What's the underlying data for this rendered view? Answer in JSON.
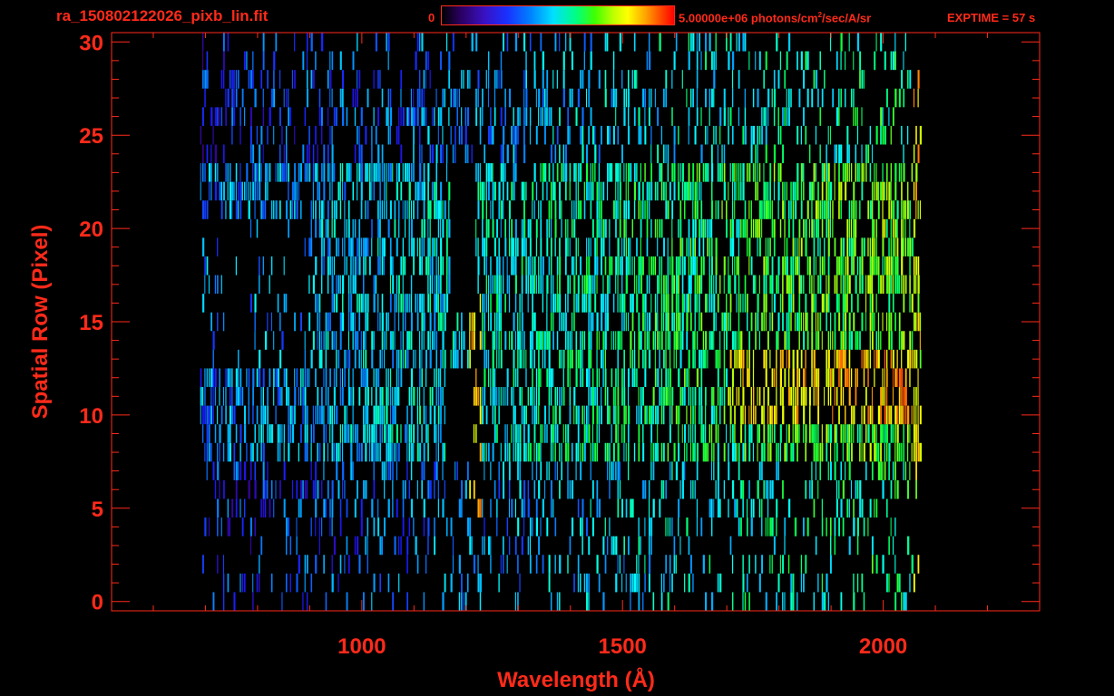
{
  "header": {
    "filename": "ra_150802122026_pixb_lin.fit",
    "colorbar_min": "0",
    "colorbar_max_value": "5.00000e+06 photons/cm",
    "colorbar_max_sup": "2",
    "colorbar_max_rest": "/sec/A/sr",
    "exptime": "EXPTIME = 57 s"
  },
  "colors": {
    "background": "#000000",
    "axis": "#ff2a1a",
    "text": "#ff2a1a"
  },
  "chart_data": {
    "type": "heatmap",
    "title": "ra_150802122026_pixb_lin.fit",
    "xlabel": "Wavelength (Å)",
    "ylabel": "Spatial Row (Pixel)",
    "xlim": [
      520,
      2300
    ],
    "ylim": [
      -0.5,
      30.5
    ],
    "x_ticks": [
      1000,
      1500,
      2000
    ],
    "x_tick_labels": [
      "1000",
      "1500",
      "2000"
    ],
    "y_ticks": [
      0,
      5,
      10,
      15,
      20,
      25,
      30
    ],
    "y_tick_labels": [
      "0",
      "5",
      "10",
      "15",
      "20",
      "25",
      "30"
    ],
    "colorscale": {
      "min": 0,
      "max": 5000000,
      "units": "photons/cm^2/sec/A/sr",
      "palette": [
        "#000000",
        "#3a0080",
        "#1a1aff",
        "#00a0ff",
        "#00ffff",
        "#00ff40",
        "#c0ff00",
        "#ffff00",
        "#ff8000",
        "#ff0000"
      ]
    },
    "grid": false,
    "bright_features": [
      {
        "wavelength": 1216,
        "label": "",
        "rows": [
          5,
          16
        ]
      },
      {
        "wavelength": 2060,
        "label": "",
        "rows": [
          4,
          30
        ]
      }
    ],
    "masked_columns": [
      {
        "wavelength_range": [
          1170,
          1215
        ],
        "rows": [
          16,
          23
        ]
      },
      {
        "wavelength_range": [
          1160,
          1210
        ],
        "rows": [
          8,
          12
        ]
      }
    ],
    "wavelength_extent": [
      690,
      2070
    ],
    "row_extent": [
      0,
      30
    ]
  }
}
